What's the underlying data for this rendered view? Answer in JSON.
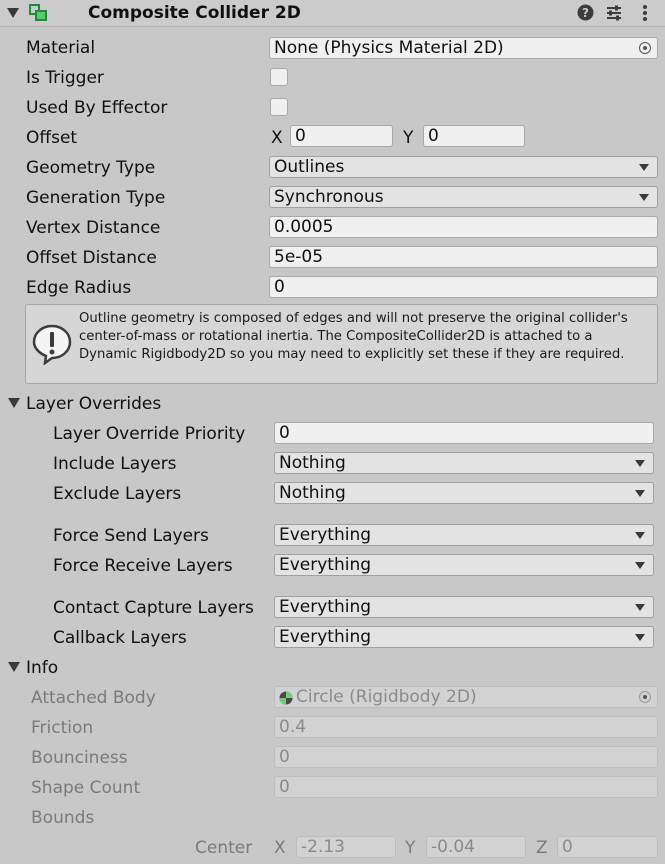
{
  "header": {
    "title": "Composite Collider 2D",
    "icons": [
      "foldout-arrow-icon",
      "composite-collider-icon",
      "help-icon",
      "preset-icon",
      "more-icon"
    ]
  },
  "fields": {
    "material": {
      "label": "Material",
      "value": "None (Physics Material 2D)"
    },
    "is_trigger": {
      "label": "Is Trigger",
      "checked": false
    },
    "used_by_effector": {
      "label": "Used By Effector",
      "checked": false
    },
    "offset": {
      "label": "Offset",
      "x_label": "X",
      "x": "0",
      "y_label": "Y",
      "y": "0"
    },
    "geometry_type": {
      "label": "Geometry Type",
      "value": "Outlines"
    },
    "generation_type": {
      "label": "Generation Type",
      "value": "Synchronous"
    },
    "vertex_distance": {
      "label": "Vertex Distance",
      "value": "0.0005"
    },
    "offset_distance": {
      "label": "Offset Distance",
      "value": "5e-05"
    },
    "edge_radius": {
      "label": "Edge Radius",
      "value": "0"
    }
  },
  "help_box": {
    "text": "Outline geometry is composed of edges and will not preserve the original collider's center-of-mass or rotational inertia.  The CompositeCollider2D is attached to a Dynamic Rigidbody2D so you may need to explicitly set these if they are required."
  },
  "layer_overrides": {
    "title": "Layer Overrides",
    "priority": {
      "label": "Layer Override Priority",
      "value": "0"
    },
    "include": {
      "label": "Include Layers",
      "value": "Nothing"
    },
    "exclude": {
      "label": "Exclude Layers",
      "value": "Nothing"
    },
    "force_send": {
      "label": "Force Send Layers",
      "value": "Everything"
    },
    "force_receive": {
      "label": "Force Receive Layers",
      "value": "Everything"
    },
    "contact_capture": {
      "label": "Contact Capture Layers",
      "value": "Everything"
    },
    "callback": {
      "label": "Callback Layers",
      "value": "Everything"
    }
  },
  "info": {
    "title": "Info",
    "attached_body": {
      "label": "Attached Body",
      "value": "Circle (Rigidbody 2D)"
    },
    "friction": {
      "label": "Friction",
      "value": "0.4"
    },
    "bounciness": {
      "label": "Bounciness",
      "value": "0"
    },
    "shape_count": {
      "label": "Shape Count",
      "value": "0"
    },
    "bounds": {
      "label": "Bounds"
    },
    "center": {
      "label": "Center",
      "x_label": "X",
      "x": "-2.13",
      "y_label": "Y",
      "y": "-0.04",
      "z_label": "Z",
      "z": "0"
    }
  },
  "colors": {
    "background": "#c8c8c8",
    "field": "#f0f0f0",
    "dropdown": "#e3e3e3",
    "disabled_text": "#7a7a7a"
  }
}
